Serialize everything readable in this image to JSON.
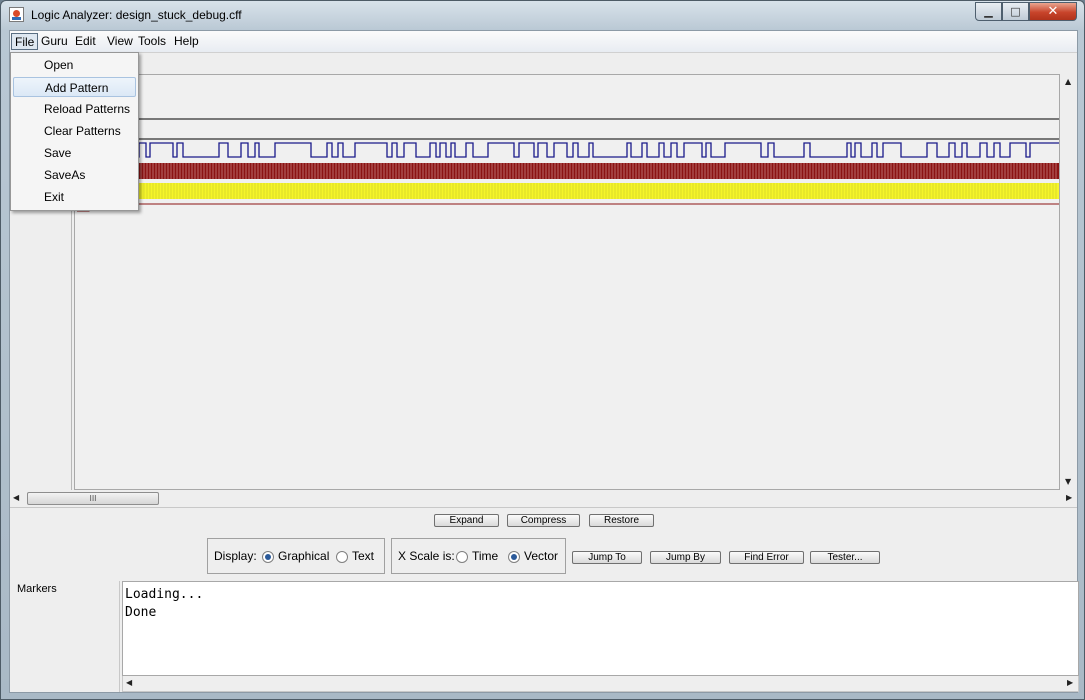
{
  "window": {
    "title": "Logic Analyzer: design_stuck_debug.cff",
    "controls": {
      "minimize": "▁",
      "maximize": "□",
      "close": "✕"
    }
  },
  "menubar": {
    "items": [
      {
        "label": "File",
        "active": true
      },
      {
        "label": "Guru"
      },
      {
        "label": "Edit"
      },
      {
        "label": "View"
      },
      {
        "label": "Tools"
      },
      {
        "label": "Help"
      }
    ]
  },
  "file_menu": {
    "items": [
      {
        "label": "Open"
      },
      {
        "label": "Add Pattern",
        "highlighted": true
      },
      {
        "label": "Reload Patterns"
      },
      {
        "label": "Clear Patterns"
      },
      {
        "label": "Save"
      },
      {
        "label": "SaveAs"
      },
      {
        "label": "Exit"
      }
    ]
  },
  "waveform": {
    "colors": {
      "clock": "#1a1a8a",
      "bus_a": "#8b1414",
      "bus_b": "#f5f52a",
      "line": "#000000"
    }
  },
  "scroll": {
    "thumb_grip": "III"
  },
  "zoom_buttons": {
    "expand": "Expand",
    "compress": "Compress",
    "restore": "Restore"
  },
  "display": {
    "label": "Display:",
    "graphical": "Graphical",
    "text": "Text",
    "selected": "Graphical"
  },
  "xscale": {
    "label": "X Scale is:",
    "time": "Time",
    "vector": "Vector",
    "selected": "Vector"
  },
  "nav_buttons": {
    "jump_to": "Jump To",
    "jump_by": "Jump By",
    "find_error": "Find Error",
    "tester": "Tester..."
  },
  "markers": {
    "label": "Markers"
  },
  "console": {
    "lines": [
      "Loading...",
      "Done"
    ]
  }
}
